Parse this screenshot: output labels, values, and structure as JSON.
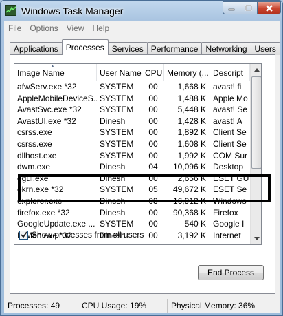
{
  "window": {
    "title": "Windows Task Manager"
  },
  "menu": [
    "File",
    "Options",
    "View",
    "Help"
  ],
  "tabs": [
    "Applications",
    "Processes",
    "Services",
    "Performance",
    "Networking",
    "Users"
  ],
  "active_tab": "Processes",
  "columns": [
    "Image Name",
    "User Name",
    "CPU",
    "Memory (...",
    "Descript"
  ],
  "rows": [
    [
      "afwServ.exe *32",
      "SYSTEM",
      "00",
      "1,668 K",
      "avast! fi"
    ],
    [
      "AppleMobileDeviceS...",
      "SYSTEM",
      "00",
      "1,488 K",
      "Apple Mo"
    ],
    [
      "AvastSvc.exe *32",
      "SYSTEM",
      "00",
      "5,448 K",
      "avast! Se"
    ],
    [
      "AvastUI.exe *32",
      "Dinesh",
      "00",
      "1,428 K",
      "avast! A"
    ],
    [
      "csrss.exe",
      "SYSTEM",
      "00",
      "1,892 K",
      "Client Se"
    ],
    [
      "csrss.exe",
      "SYSTEM",
      "00",
      "1,608 K",
      "Client Se"
    ],
    [
      "dllhost.exe",
      "SYSTEM",
      "00",
      "1,992 K",
      "COM Sur"
    ],
    [
      "dwm.exe",
      "Dinesh",
      "04",
      "10,096 K",
      "Desktop"
    ],
    [
      "egui.exe",
      "Dinesh",
      "00",
      "2,656 K",
      "ESET GU"
    ],
    [
      "ekrn.exe *32",
      "SYSTEM",
      "05",
      "49,672 K",
      "ESET Se"
    ],
    [
      "explorer.exe",
      "Dinesh",
      "03",
      "16,912 K",
      "Windows"
    ],
    [
      "firefox.exe *32",
      "Dinesh",
      "00",
      "90,368 K",
      "Firefox"
    ],
    [
      "GoogleUpdate.exe ...",
      "SYSTEM",
      "00",
      "540 K",
      "Google I"
    ],
    [
      "IDMan.exe *32",
      "Dinesh",
      "00",
      "3,192 K",
      "Internet"
    ]
  ],
  "show_all_label": "Show processes from all users",
  "show_all_checked": true,
  "end_process_label": "End Process",
  "status": {
    "processes": "Processes: 49",
    "cpu": "CPU Usage: 19%",
    "memory": "Physical Memory: 36%"
  }
}
